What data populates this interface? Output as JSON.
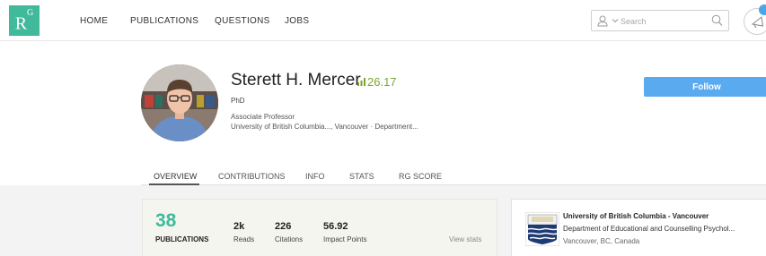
{
  "nav": {
    "logo": "R",
    "logo_sup": "G",
    "items": [
      "HOME",
      "PUBLICATIONS",
      "QUESTIONS",
      "JOBS"
    ],
    "search_placeholder": "Search"
  },
  "profile": {
    "name": "Sterett H. Mercer",
    "rg_score": "26.17",
    "degree": "PhD",
    "position": "Associate Professor",
    "institution": "University of British Columbia..., Vancouver · Department...",
    "follow_label": "Follow"
  },
  "tabs": [
    "OVERVIEW",
    "CONTRIBUTIONS",
    "INFO",
    "STATS",
    "RG SCORE"
  ],
  "stats": {
    "publications_count": "38",
    "publications_label": "PUBLICATIONS",
    "reads_value": "2k",
    "reads_label": "Reads",
    "citations_value": "226",
    "citations_label": "Citations",
    "impact_value": "56.92",
    "impact_label": "Impact Points",
    "view_stats": "View stats"
  },
  "affiliation": {
    "name": "University of British Columbia - Vancouver",
    "department": "Department of Educational and Counselling Psychol...",
    "location": "Vancouver, BC, Canada"
  },
  "colors": {
    "brand": "#40ba9b",
    "follow": "#5aaaf0",
    "score": "#7aa62a",
    "notification": "#4aa6e8"
  }
}
